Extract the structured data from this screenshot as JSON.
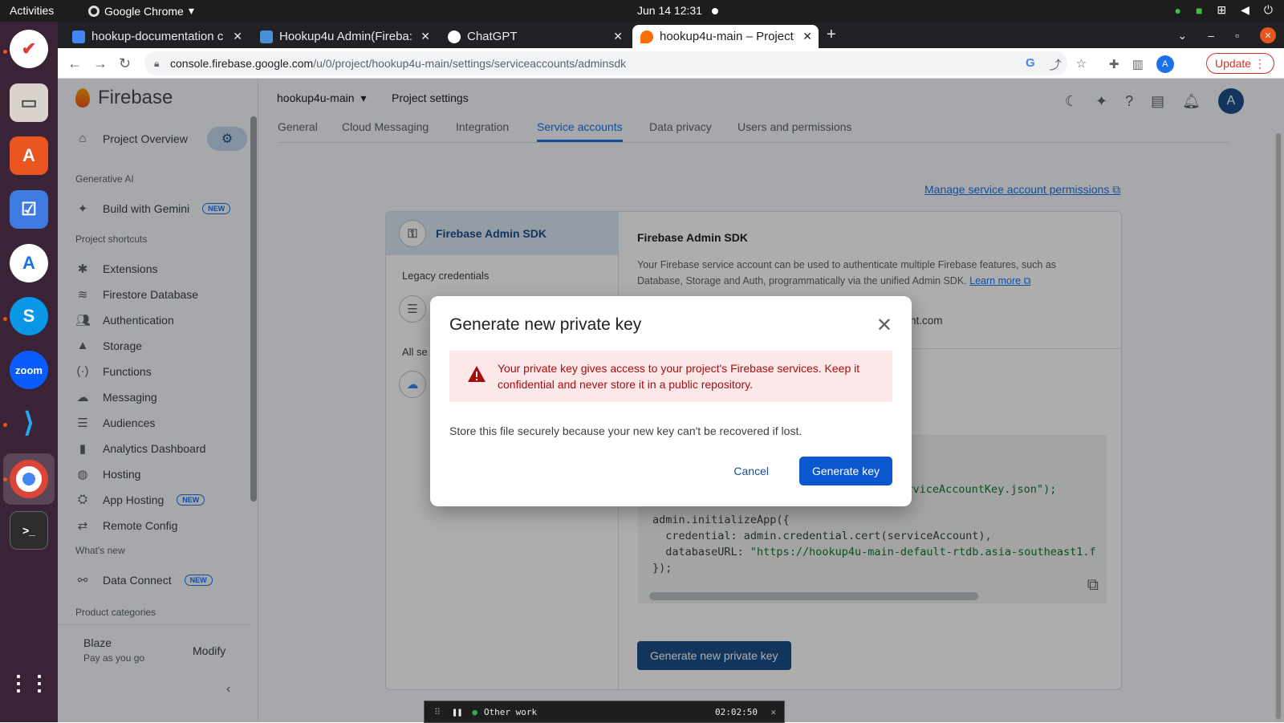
{
  "os": {
    "activities": "Activities",
    "app_name": "Google Chrome",
    "clock": "Jun 14  12:31"
  },
  "browser": {
    "tabs": [
      {
        "title": "hookup-documentation c",
        "icon": "docs-icon",
        "color": "#4285f4"
      },
      {
        "title": "Hookup4u Admin(Fireba:",
        "icon": "admin-icon",
        "color": "#4a90d9"
      },
      {
        "title": "ChatGPT",
        "icon": "chatgpt-icon",
        "color": "#ffffff"
      },
      {
        "title": "hookup4u-main – Project",
        "icon": "firebase-icon",
        "color": "#ff6d00"
      }
    ],
    "url_host": "console.firebase.google.com",
    "url_path": "/u/0/project/hookup4u-main/settings/serviceaccounts/adminsdk",
    "profile_initial": "A",
    "update_label": "Update"
  },
  "sidebar": {
    "brand": "Firebase",
    "project_overview": "Project Overview",
    "section_genai": "Generative AI",
    "build_with_gemini": "Build with Gemini",
    "new_badge": "NEW",
    "section_shortcuts": "Project shortcuts",
    "items": [
      {
        "label": "Extensions",
        "icon": "extensions-icon"
      },
      {
        "label": "Firestore Database",
        "icon": "firestore-icon"
      },
      {
        "label": "Authentication",
        "icon": "authentication-icon"
      },
      {
        "label": "Storage",
        "icon": "storage-icon"
      },
      {
        "label": "Functions",
        "icon": "functions-icon"
      },
      {
        "label": "Messaging",
        "icon": "messaging-icon"
      },
      {
        "label": "Audiences",
        "icon": "audiences-icon"
      },
      {
        "label": "Analytics Dashboard",
        "icon": "analytics-icon"
      },
      {
        "label": "Hosting",
        "icon": "hosting-icon"
      },
      {
        "label": "App Hosting",
        "icon": "app-hosting-icon"
      },
      {
        "label": "Remote Config",
        "icon": "remote-config-icon"
      }
    ],
    "section_whats_new": "What's new",
    "data_connect": "Data Connect",
    "section_categories": "Product categories",
    "plan_name": "Blaze",
    "plan_desc": "Pay as you go",
    "modify": "Modify"
  },
  "header": {
    "project": "hookup4u-main",
    "page": "Project settings",
    "avatar": "A"
  },
  "subtabs": [
    "General",
    "Cloud Messaging",
    "Integration",
    "Service accounts",
    "Data privacy",
    "Users and permissions"
  ],
  "content": {
    "manage_link": "Manage service account permissions",
    "left_selected": "Firebase Admin SDK",
    "legacy_credentials": "Legacy credentials",
    "all_service_prefix": "All se",
    "heading": "Firebase Admin SDK",
    "desc1": "Your Firebase service account can be used to authenticate multiple Firebase features, such as",
    "desc2": "Database, Storage and Auth, programmatically via the unified Admin SDK.",
    "learn_more": "Learn more",
    "account_suffix": "account.com",
    "code_line1_tail": ";",
    "code_line2_tail": "/serviceAccountKey.json\");",
    "code_line3": "admin.initializeApp({",
    "code_line4": "  credential: admin.credential.cert(serviceAccount),",
    "code_line5_key": "  databaseURL: ",
    "code_line5_val": "\"https://hookup4u-main-default-rtdb.asia-southeast1.f",
    "code_line6": "});",
    "generate_btn": "Generate new private key"
  },
  "dialog": {
    "title": "Generate new private key",
    "warning": "Your private key gives access to your project's Firebase services. Keep it confidential and never store it in a public repository.",
    "body": "Store this file securely because your new key can't be recovered if lost.",
    "cancel": "Cancel",
    "confirm": "Generate key"
  },
  "timer": {
    "label": "Other work",
    "time": "02:02:50"
  },
  "colors": {
    "accent": "#1a73e8",
    "primary_button": "#0b57d0",
    "warning_bg": "#fce8e8",
    "warning_text": "#a50e0e"
  }
}
